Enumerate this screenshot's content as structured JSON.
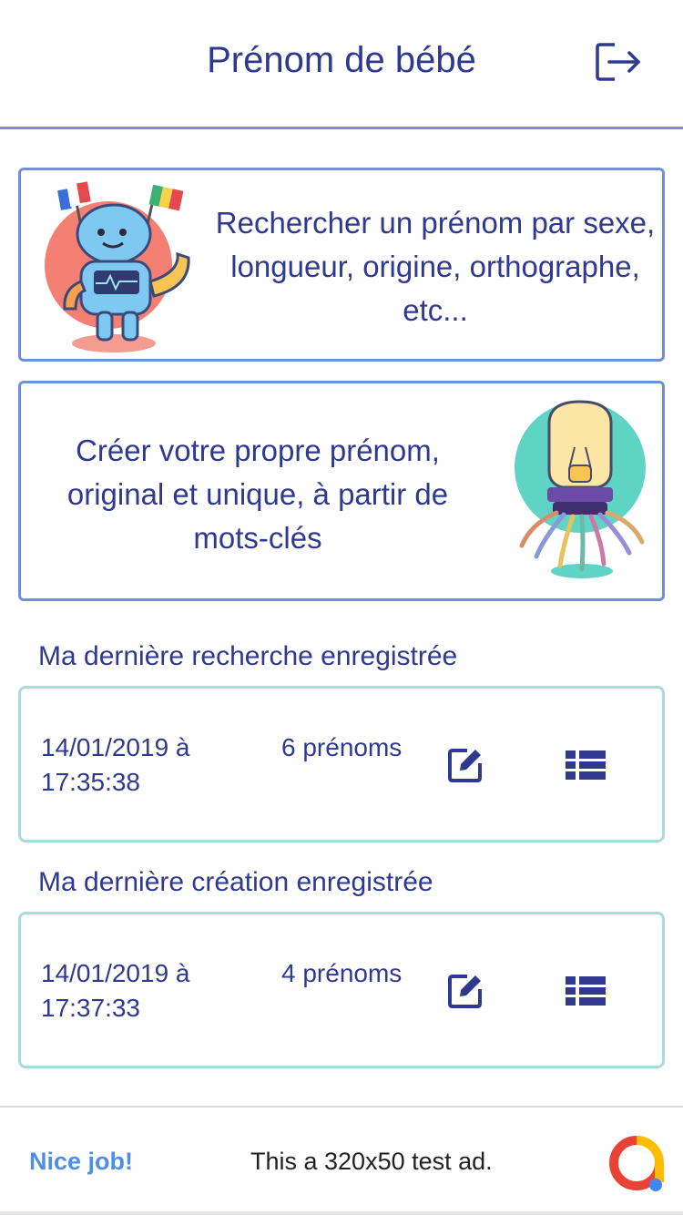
{
  "header": {
    "title": "Prénom de bébé",
    "logout_icon": "logout-icon"
  },
  "cards": {
    "search": {
      "text": "Rechercher un prénom par sexe, longueur, origine, orthographe, etc...",
      "illustration": "robot-with-flags-illustration"
    },
    "create": {
      "text": "Créer votre propre prénom, original et unique, à partir de mots-clés",
      "illustration": "lightbulb-octopus-illustration"
    }
  },
  "last_search": {
    "title": "Ma dernière recherche enregistrée",
    "date": "14/01/2019 à 17:35:38",
    "count": "6 prénoms",
    "edit_icon": "edit-icon",
    "list_icon": "list-icon"
  },
  "last_creation": {
    "title": "Ma dernière création enregistrée",
    "date": "14/01/2019 à 17:37:33",
    "count": "4 prénoms",
    "edit_icon": "edit-icon",
    "list_icon": "list-icon"
  },
  "ad": {
    "left_label": "Nice job!",
    "text": "This a 320x50 test ad."
  },
  "colors": {
    "primary": "#2f3a8f",
    "border_blue": "#6f8fdc",
    "border_teal": "#a8dcdc",
    "ad_link": "#4d8ee8"
  }
}
